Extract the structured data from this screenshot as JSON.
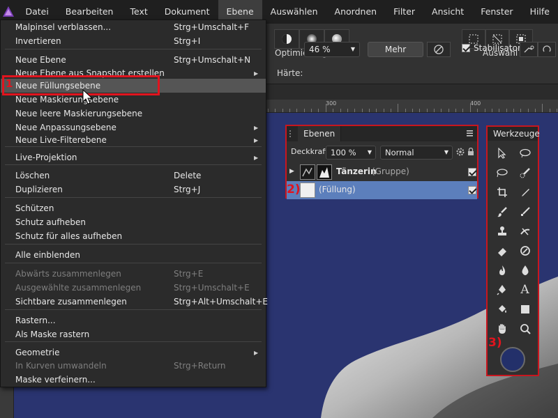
{
  "menubar": {
    "items": [
      "Datei",
      "Bearbeiten",
      "Text",
      "Dokument",
      "Ebene",
      "Auswählen",
      "Anordnen",
      "Filter",
      "Ansicht",
      "Fenster",
      "Hilfe"
    ],
    "active_item": "Ebene"
  },
  "context_toolbar": {
    "optimierung_label": "Optimierung",
    "auswahl_label": "Auswahl",
    "haerte_label": "Härte:",
    "haerte_value": "46 %",
    "mehr_label": "Mehr",
    "stabilisator_label": "Stabilisator"
  },
  "ruler": {
    "labels": [
      "300",
      "400"
    ]
  },
  "menu": {
    "items": [
      {
        "label": "Malpinsel verblassen...",
        "shortcut": "Strg+Umschalt+F"
      },
      {
        "label": "Invertieren",
        "shortcut": "Strg+I"
      },
      {
        "label": "Neue Ebene",
        "shortcut": "Strg+Umschalt+N"
      },
      {
        "label": "Neue Ebene aus Snapshot erstellen",
        "submenu": true
      },
      {
        "label": "Neue Füllungsebene",
        "highlighted": true
      },
      {
        "label": "Neue Maskierungsebene"
      },
      {
        "label": "Neue leere Maskierungsebene"
      },
      {
        "label": "Neue Anpassungsebene",
        "submenu": true
      },
      {
        "label": "Neue Live-Filterebene",
        "submenu": true
      },
      {
        "label": "Live-Projektion",
        "submenu": true
      },
      {
        "label": "Löschen",
        "shortcut": "Delete"
      },
      {
        "label": "Duplizieren",
        "shortcut": "Strg+J"
      },
      {
        "label": "Schützen"
      },
      {
        "label": "Schutz aufheben"
      },
      {
        "label": "Schutz für alles aufheben"
      },
      {
        "label": "Alle einblenden"
      },
      {
        "label": "Abwärts zusammenlegen",
        "shortcut": "Strg+E",
        "disabled": true
      },
      {
        "label": "Ausgewählte zusammenlegen",
        "shortcut": "Strg+Umschalt+E",
        "disabled": true
      },
      {
        "label": "Sichtbare zusammenlegen",
        "shortcut": "Strg+Alt+Umschalt+E"
      },
      {
        "label": "Rastern..."
      },
      {
        "label": "Als Maske rastern"
      },
      {
        "label": "Geometrie",
        "submenu": true
      },
      {
        "label": "In Kurven umwandeln",
        "shortcut": "Strg+Return",
        "disabled": true
      },
      {
        "label": "Maske verfeinern..."
      }
    ]
  },
  "annotations": {
    "one": "1",
    "two": "2)",
    "three": "3)"
  },
  "layers_panel": {
    "tab_label": "Ebenen",
    "opacity_label": "Deckkraft:",
    "opacity_value": "100 %",
    "blend_mode": "Normal",
    "layers": [
      {
        "name": "Tänzerin",
        "suffix": "(Gruppe)",
        "visible": true,
        "selected": false
      },
      {
        "name": "(Füllung)",
        "visible": true,
        "selected": true
      }
    ]
  },
  "tools_panel": {
    "title": "Werkzeuge",
    "tools": [
      "move-tool",
      "marquee-select-tool",
      "freehand-select-tool",
      "selection-brush-tool",
      "crop-tool",
      "color-picker-tool",
      "paint-brush-tool",
      "pixel-brush-tool",
      "clone-stamp-tool",
      "retouch-tool",
      "erase-tool",
      "dodge-tool",
      "burn-tool",
      "blur-tool",
      "pen-tool",
      "text-tool",
      "fill-tool",
      "rectangle-tool",
      "hand-tool",
      "zoom-tool"
    ],
    "text_tool_glyph": "A",
    "primary_color": "#23306a"
  },
  "colors": {
    "accent_red": "#e1141e",
    "selection_blue": "#5c7fbc",
    "canvas_blue": "#2a3470"
  }
}
